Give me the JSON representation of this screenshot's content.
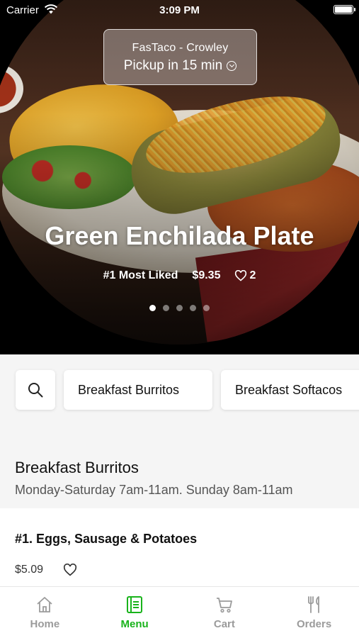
{
  "status_bar": {
    "carrier": "Carrier",
    "time": "3:09 PM"
  },
  "pickup": {
    "store": "FasTaco - Crowley",
    "eta": "Pickup in 15 min"
  },
  "hero": {
    "title": "Green Enchilada Plate",
    "tag": "#1 Most Liked",
    "price": "$9.35",
    "likes": "2",
    "carousel_pages": 5,
    "carousel_active_index": 0
  },
  "categories": [
    "Breakfast Burritos",
    "Breakfast Softacos"
  ],
  "section": {
    "title": "Breakfast Burritos",
    "subtitle": "Monday-Saturday 7am-11am. Sunday 8am-11am"
  },
  "items": [
    {
      "name": "#1. Eggs, Sausage & Potatoes",
      "price": "$5.09"
    }
  ],
  "tabs": [
    {
      "label": "Home",
      "icon": "home-icon",
      "active": false
    },
    {
      "label": "Menu",
      "icon": "menu-icon",
      "active": true
    },
    {
      "label": "Cart",
      "icon": "cart-icon",
      "active": false
    },
    {
      "label": "Orders",
      "icon": "orders-icon",
      "active": false
    }
  ],
  "colors": {
    "accent": "#19b31b",
    "tab_inactive": "#9b9b9b"
  }
}
